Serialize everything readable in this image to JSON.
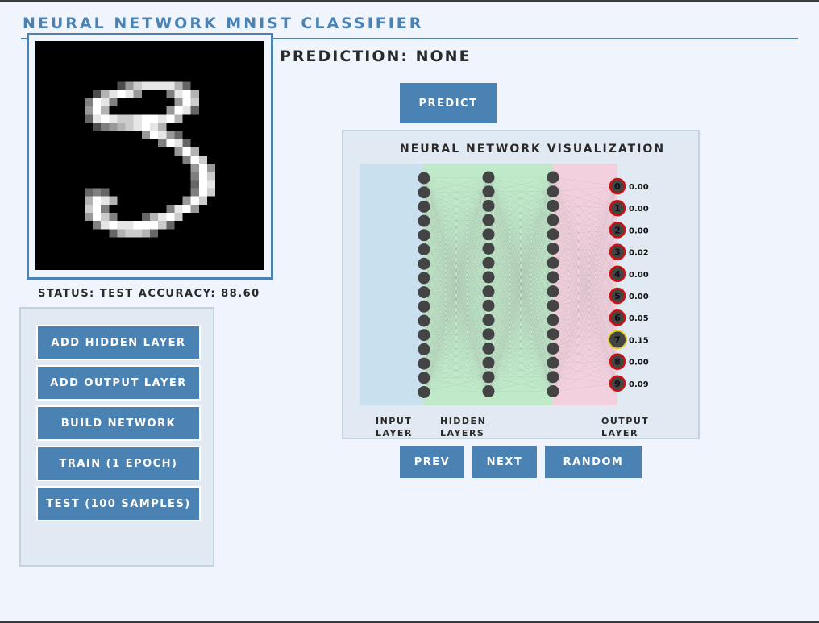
{
  "app": {
    "title": "NEURAL NETWORK MNIST CLASSIFIER"
  },
  "prediction": {
    "text": "PREDICTION: NONE"
  },
  "status": {
    "text": "STATUS: TEST ACCURACY: 88.60"
  },
  "buttons": {
    "predict": "PREDICT",
    "add_hidden": "ADD HIDDEN LAYER",
    "add_output": "ADD OUTPUT LAYER",
    "build": "BUILD NETWORK",
    "train": "TRAIN (1 EPOCH)",
    "test": "TEST (100 SAMPLES)",
    "prev": "PREV",
    "next": "NEXT",
    "random": "RANDOM"
  },
  "visualization": {
    "title": "NEURAL NETWORK VISUALIZATION",
    "labels": {
      "input": "INPUT LAYER",
      "hidden": "HIDDEN LAYERS",
      "output": "OUTPUT LAYER"
    },
    "output_nodes": [
      {
        "digit": "0",
        "prob": "0.00"
      },
      {
        "digit": "1",
        "prob": "0.00"
      },
      {
        "digit": "2",
        "prob": "0.00"
      },
      {
        "digit": "3",
        "prob": "0.02"
      },
      {
        "digit": "4",
        "prob": "0.00"
      },
      {
        "digit": "5",
        "prob": "0.00"
      },
      {
        "digit": "6",
        "prob": "0.05"
      },
      {
        "digit": "7",
        "prob": "0.15"
      },
      {
        "digit": "8",
        "prob": "0.00"
      },
      {
        "digit": "9",
        "prob": "0.09"
      }
    ],
    "highlighted_digit": "7",
    "colors": {
      "input_band": "#c9e1ee",
      "hidden_band": "#bfe9c9",
      "output_band": "#f2d0dd",
      "node": "#444444",
      "output_ring": "#cc1111",
      "highlight_ring": "#e3cf2a",
      "connection": "#999999"
    }
  }
}
